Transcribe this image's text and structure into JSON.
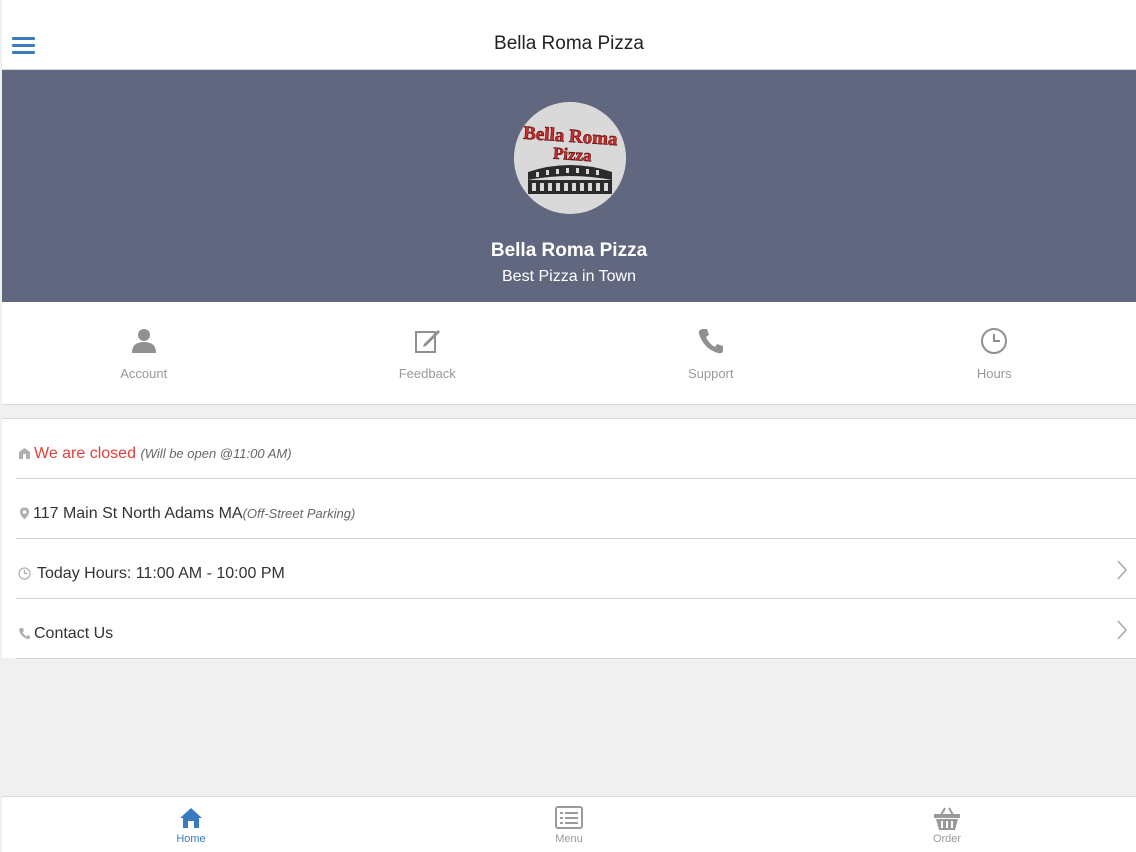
{
  "header": {
    "title": "Bella Roma Pizza",
    "menu_icon": "hamburger-menu-icon"
  },
  "banner": {
    "logo_text_line1": "Bella Roma",
    "logo_text_line2": "Pizza",
    "name": "Bella Roma Pizza",
    "tagline": "Best Pizza in Town",
    "background": "#626780"
  },
  "quick_actions": [
    {
      "label": "Account",
      "icon": "user-icon"
    },
    {
      "label": "Feedback",
      "icon": "edit-icon"
    },
    {
      "label": "Support",
      "icon": "phone-icon"
    },
    {
      "label": "Hours",
      "icon": "clock-icon"
    }
  ],
  "info": {
    "status": {
      "text": "We are closed",
      "note": "(Will be open @11:00 AM)",
      "icon": "store-icon",
      "color": "#e2403b"
    },
    "address": {
      "text": "117 Main St North Adams MA",
      "note": "(Off-Street Parking)",
      "icon": "map-pin-icon"
    },
    "hours": {
      "text": "Today Hours: 11:00 AM - 10:00 PM",
      "icon": "clock-icon"
    },
    "contact": {
      "text": "Contact Us",
      "icon": "phone-icon"
    }
  },
  "tabs": [
    {
      "label": "Home",
      "icon": "home-icon",
      "active": true
    },
    {
      "label": "Menu",
      "icon": "menu-list-icon",
      "active": false
    },
    {
      "label": "Order",
      "icon": "basket-icon",
      "active": false
    }
  ],
  "colors": {
    "accent": "#3a7bbf",
    "muted": "#999999",
    "closed": "#e2403b"
  }
}
